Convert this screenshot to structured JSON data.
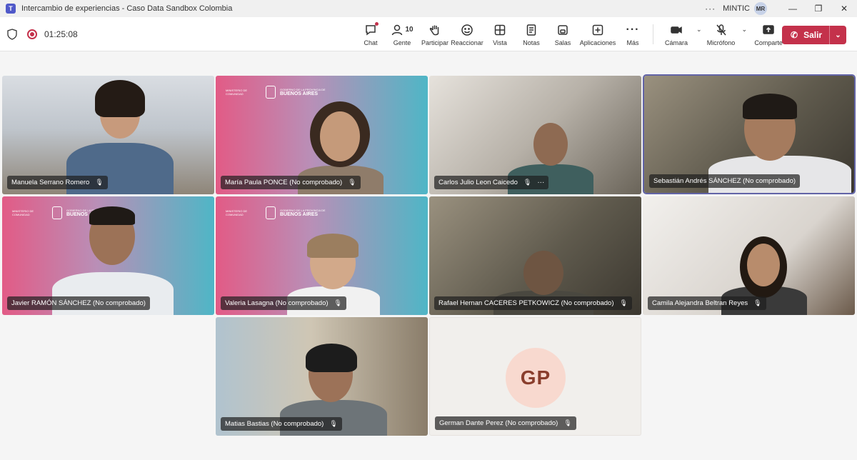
{
  "window": {
    "title": "Intercambio de experiencias - Caso Data Sandbox Colombia",
    "org": "MINTIC",
    "user_initials": "MR",
    "minimize": "—",
    "maximize": "❐",
    "close": "✕"
  },
  "meeting": {
    "timer": "01:25:08"
  },
  "toolbar": {
    "chat": "Chat",
    "people": "Gente",
    "people_count": "10",
    "raise": "Participar",
    "react": "Reaccionar",
    "view": "Vista",
    "notes": "Notas",
    "rooms": "Salas",
    "apps": "Aplicaciones",
    "more": "Más",
    "camera": "Cámara",
    "mic": "Micrófono",
    "share": "Comparte",
    "leave": "Salir"
  },
  "participants": [
    {
      "name": "Manuela Serrano Romero"
    },
    {
      "name": "María Paula PONCE (No comprobado)"
    },
    {
      "name": "Carlos Julio Leon Caicedo"
    },
    {
      "name": "Sebastián Andrés SÁNCHEZ (No comprobado)"
    },
    {
      "name": "Javier RAMÓN SÁNCHEZ (No comprobado)"
    },
    {
      "name": "Valeria Lasagna (No comprobado)"
    },
    {
      "name": "Rafael Hernan CACERES PETKOWICZ (No comprobado)"
    },
    {
      "name": "Camila Alejandra Beltran Reyes"
    },
    {
      "name": "Matias Bastias (No comprobado)"
    },
    {
      "name": "German Dante Perez (No comprobado)",
      "initials": "GP"
    }
  ],
  "brand": {
    "ministry": "MINISTERIO DE COMUNIDAD",
    "gov": "GOBIERNO DE LA PROVINCIA DE",
    "province": "BUENOS AIRES"
  },
  "colors": {
    "accent": "#6264a7",
    "leave": "#c4314b",
    "avatar_bg": "#f8d9cf"
  },
  "icons": {
    "mic_muted": "🎙",
    "more": "···"
  }
}
